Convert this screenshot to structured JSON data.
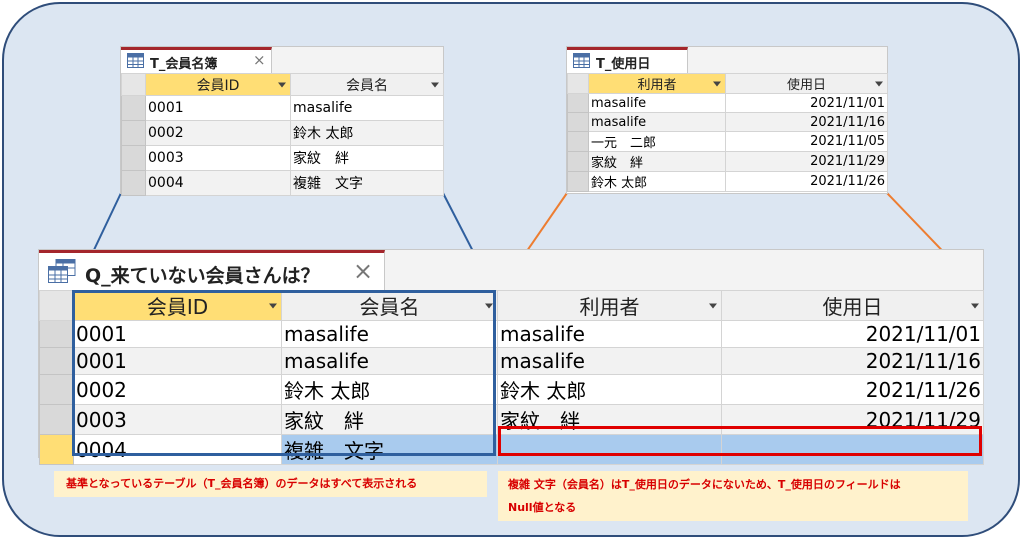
{
  "colors": {
    "accent_tab": "#a4262c",
    "highlight_header": "#ffde75",
    "blue_highlight_box": "#2f5f9e",
    "red_box": "#e00000",
    "orange_line": "#ed7d31",
    "note_bg": "#fff2cc",
    "note_text": "#d80000",
    "selected_blue_row": "#a9cbee"
  },
  "members_table": {
    "tab_title": "T_会員名簿",
    "icon": "table-icon",
    "close_glyph": "×",
    "columns": [
      "会員ID",
      "会員名"
    ],
    "rows": [
      [
        "0001",
        "masalife"
      ],
      [
        "0002",
        "鈴木 太郎"
      ],
      [
        "0003",
        "家紋　絆"
      ],
      [
        "0004",
        "複雑　文字"
      ]
    ]
  },
  "usage_table": {
    "tab_title": "T_使用日",
    "icon": "table-icon",
    "close_glyph": "",
    "columns": [
      "利用者",
      "使用日"
    ],
    "rows": [
      [
        "masalife",
        "2021/11/01"
      ],
      [
        "masalife",
        "2021/11/16"
      ],
      [
        "一元　二郎",
        "2021/11/05"
      ],
      [
        "家紋　絆",
        "2021/11/29"
      ],
      [
        "鈴木 太郎",
        "2021/11/26"
      ]
    ]
  },
  "query": {
    "tab_title": "Q_来ていない会員さんは？",
    "icon": "query-icon",
    "close_glyph": "×",
    "columns": [
      "会員ID",
      "会員名",
      "利用者",
      "使用日"
    ],
    "rows": [
      [
        "0001",
        "masalife",
        "masalife",
        "2021/11/01"
      ],
      [
        "0001",
        "masalife",
        "masalife",
        "2021/11/16"
      ],
      [
        "0002",
        "鈴木 太郎",
        "鈴木 太郎",
        "2021/11/26"
      ],
      [
        "0003",
        "家紋　絆",
        "家紋　絆",
        "2021/11/29"
      ],
      [
        "0004",
        "複雑　文字",
        "",
        ""
      ]
    ]
  },
  "notes": {
    "left": "基準となっているテーブル（T_会員名簿）のデータはすべて表示される",
    "right_line1": "複雑 文字（会員名）はT_使用日のデータにないため、T_使用日のフィールドは",
    "right_line2": "Null値となる"
  }
}
